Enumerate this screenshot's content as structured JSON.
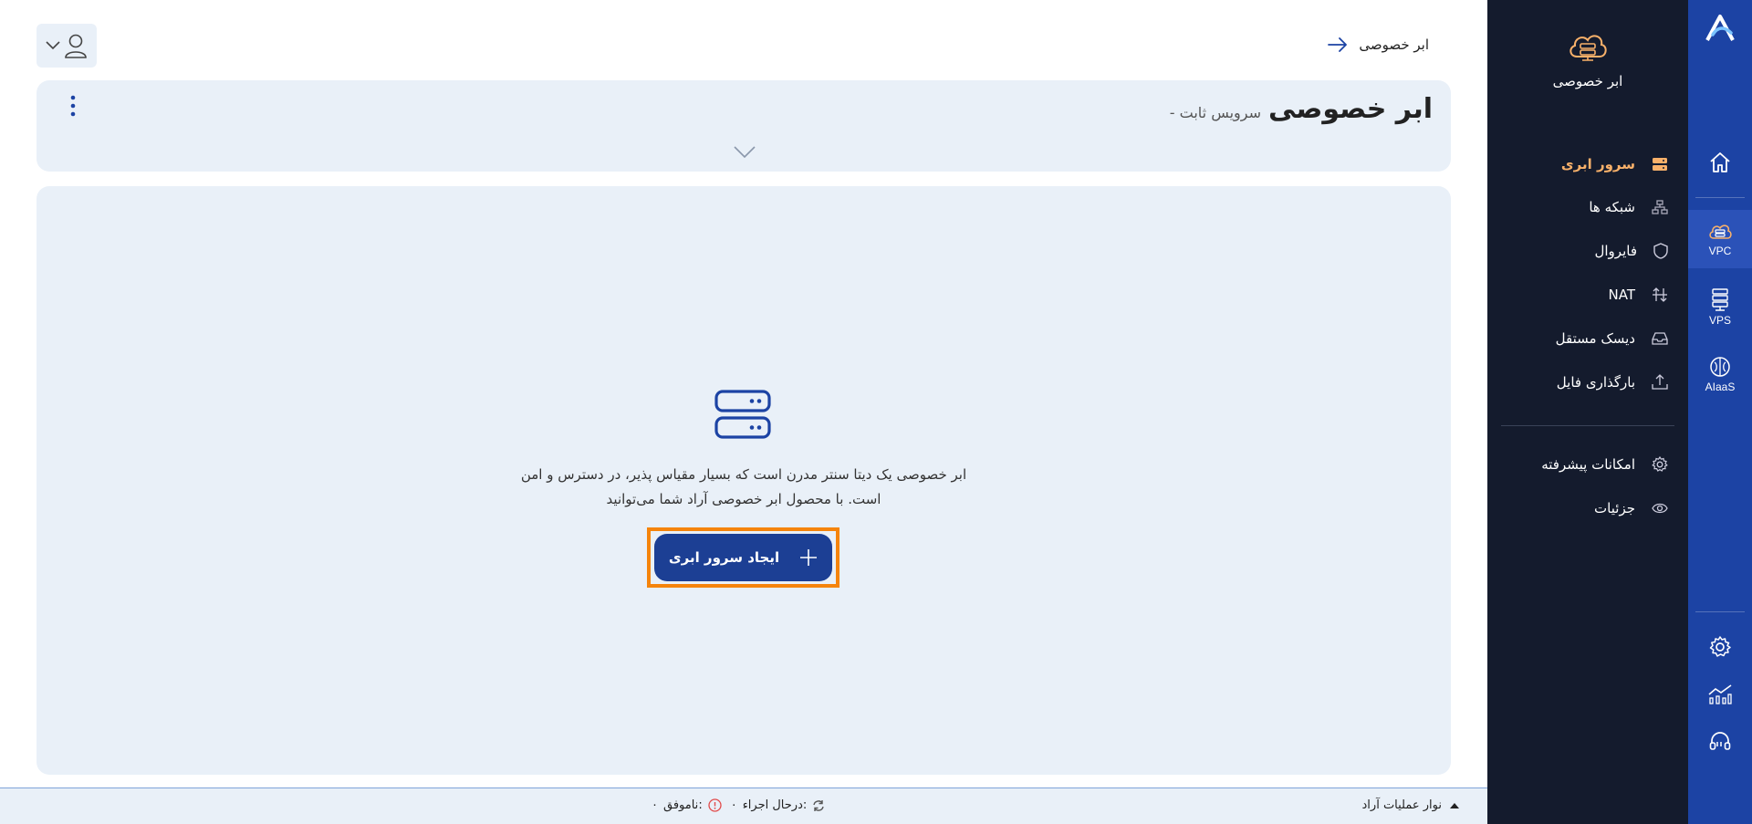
{
  "rail": {
    "items": [
      {
        "icon": "home-icon",
        "label": ""
      },
      {
        "icon": "vpc-cloud-icon",
        "label": "VPC"
      },
      {
        "icon": "vps-server-icon",
        "label": "VPS"
      },
      {
        "icon": "aiaas-brain-icon",
        "label": "AIaaS"
      },
      {
        "icon": "settings-gear-icon",
        "label": ""
      },
      {
        "icon": "analytics-chart-icon",
        "label": ""
      },
      {
        "icon": "support-headset-icon",
        "label": ""
      }
    ]
  },
  "subnav": {
    "title": "ابر خصوصی",
    "items": [
      {
        "label": "سرور ابری",
        "icon": "server-icon",
        "active": true
      },
      {
        "label": "شبکه ها",
        "icon": "network-icon"
      },
      {
        "label": "فایروال",
        "icon": "shield-icon"
      },
      {
        "label": "NAT",
        "icon": "arrows-swap-icon"
      },
      {
        "label": "دیسک مستقل",
        "icon": "inbox-disk-icon"
      },
      {
        "label": "بارگذاری فایل",
        "icon": "upload-icon"
      },
      {
        "label": "امکانات پیشرفته",
        "icon": "gear-icon"
      },
      {
        "label": "جزئیات",
        "icon": "eye-icon"
      }
    ]
  },
  "header": {
    "back_label": "ابر خصوصی",
    "title": "ابر خصوصی",
    "subtitle": "- سرویس ثابت"
  },
  "empty_state": {
    "line1": "ابر خصوصی یک دیتا سنتر مدرن است که بسیار مقیاس پذیر، در دسترس و امن",
    "line2": "است. با محصول ابر خصوصی آراد شما می‌توانید",
    "cta_label": "ایجاد سرور ابری"
  },
  "bottom_bar": {
    "ops_label": "نوار عملیات آراد",
    "running_label": "درحال اجراء:",
    "running_count": "۰",
    "failed_label": "ناموفق:",
    "failed_count": "۰"
  },
  "colors": {
    "rail_blue": "#1c43a4",
    "subnav_dark": "#141b2d",
    "active_orange": "#f9b16a",
    "card_bg": "#e9f0f8",
    "cta_blue": "#1c3f94",
    "highlight_orange": "#f5840c"
  }
}
